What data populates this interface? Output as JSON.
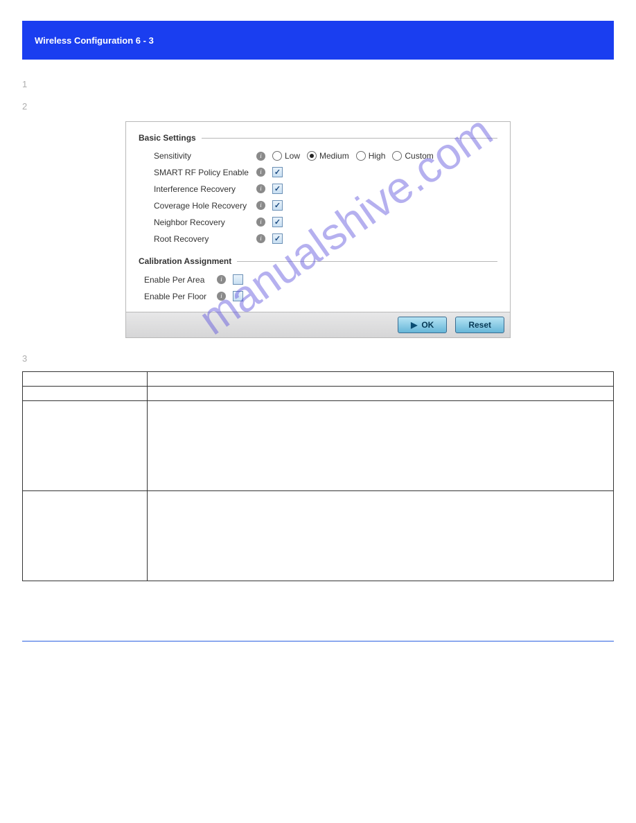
{
  "header": {
    "left": "Wireless Configuration  6 - 3",
    "right": ""
  },
  "intro": [
    "",
    ""
  ],
  "step1": {
    "num": "1",
    "text": ""
  },
  "step2": {
    "num": "2",
    "text": ""
  },
  "fig_caption": "",
  "panel": {
    "section1": "Basic Settings",
    "rows": {
      "sensitivity": {
        "label": "Sensitivity",
        "opt_low": "Low",
        "opt_medium": "Medium",
        "opt_high": "High",
        "opt_custom": "Custom"
      },
      "enable": {
        "label": "SMART RF Policy Enable"
      },
      "interference": {
        "label": "Interference Recovery"
      },
      "coverage": {
        "label": "Coverage Hole Recovery"
      },
      "neighbor": {
        "label": "Neighbor Recovery"
      },
      "root": {
        "label": "Root Recovery"
      }
    },
    "section2": "Calibration Assignment",
    "rows2": {
      "area": {
        "label": "Enable Per Area"
      },
      "floor": {
        "label": "Enable Per Floor"
      }
    },
    "buttons": {
      "ok": "OK",
      "reset": "Reset"
    }
  },
  "watermark": "manualshive.com",
  "step3": {
    "num": "3",
    "text": ""
  },
  "refer_note": "",
  "table": [
    {
      "key": "",
      "val": ""
    },
    {
      "key": "",
      "val": ""
    },
    {
      "key": "",
      "val": ""
    },
    {
      "key": "",
      "val": ""
    }
  ],
  "footer": {
    "manual_link": "",
    "download_link": ""
  }
}
